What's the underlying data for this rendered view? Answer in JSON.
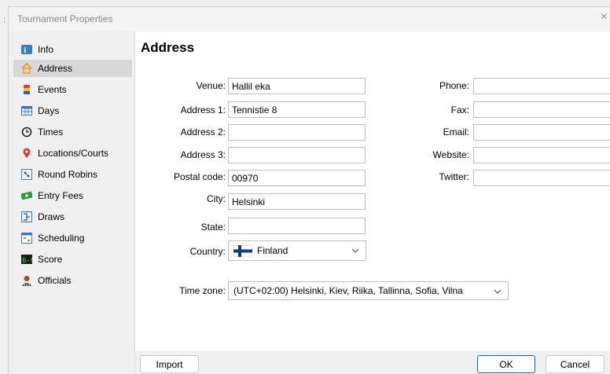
{
  "window": {
    "title": "Tournament Properties",
    "close_glyph": "×"
  },
  "sidebar": {
    "items": [
      {
        "label": "Info",
        "icon": "info-icon"
      },
      {
        "label": "Address",
        "icon": "home-icon",
        "active": true
      },
      {
        "label": "Events",
        "icon": "events-icon"
      },
      {
        "label": "Days",
        "icon": "calendar-icon"
      },
      {
        "label": "Times",
        "icon": "clock-icon"
      },
      {
        "label": "Locations/Courts",
        "icon": "location-pin-icon"
      },
      {
        "label": "Round Robins",
        "icon": "round-robin-icon"
      },
      {
        "label": "Entry Fees",
        "icon": "money-icon"
      },
      {
        "label": "Draws",
        "icon": "draws-icon"
      },
      {
        "label": "Scheduling",
        "icon": "scheduling-icon"
      },
      {
        "label": "Score",
        "icon": "score-icon"
      },
      {
        "label": "Officials",
        "icon": "officials-icon"
      }
    ]
  },
  "address": {
    "heading": "Address",
    "venue": {
      "label": "Venue:",
      "value": "Hallil eka"
    },
    "address1": {
      "label": "Address 1:",
      "value": "Tennistie 8"
    },
    "address2": {
      "label": "Address 2:",
      "value": ""
    },
    "address3": {
      "label": "Address 3:",
      "value": ""
    },
    "postal_code": {
      "label": "Postal code:",
      "value": "00970"
    },
    "city": {
      "label": "City:",
      "value": "Helsinki"
    },
    "state": {
      "label": "State:",
      "value": ""
    },
    "country": {
      "label": "Country:",
      "value": "Finland"
    },
    "phone": {
      "label": "Phone:",
      "value": ""
    },
    "fax": {
      "label": "Fax:",
      "value": ""
    },
    "email": {
      "label": "Email:",
      "value": ""
    },
    "website": {
      "label": "Website:",
      "value": ""
    },
    "twitter": {
      "label": "Twitter:",
      "value": ""
    },
    "time_zone": {
      "label": "Time zone:",
      "value": "(UTC+02:00) Helsinki, Kiev, Riika, Tallinna, Sofia, Vilna"
    }
  },
  "footer": {
    "import_label": "Import",
    "ok_label": "OK",
    "cancel_label": "Cancel"
  },
  "colors": {
    "flag_blue": "#0a3a8c",
    "accent": "#0a64c8",
    "active_nav": "#d7d7d7"
  }
}
